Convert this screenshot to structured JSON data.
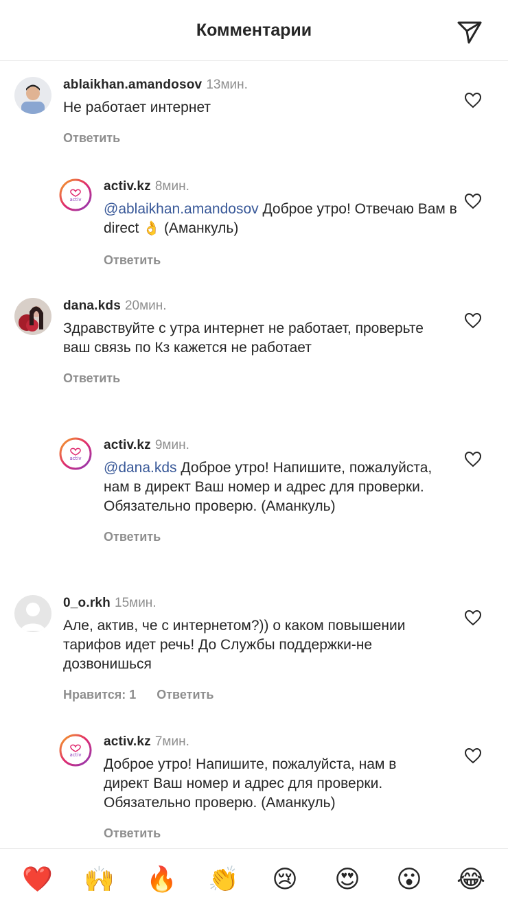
{
  "header": {
    "title": "Комментарии",
    "share_icon": "paper-plane-icon"
  },
  "comments": [
    {
      "username": "ablaikhan.amandosov",
      "time": "13мин.",
      "text": "Не работает интернет",
      "mention": "",
      "reply": "Ответить",
      "likes": ""
    },
    {
      "username": "activ.kz",
      "time": "8мин.",
      "mention": "@ablaikhan.amandosov",
      "text": " Доброе утро! Отвечаю Вам в direct",
      "emoji": "👌",
      "text_after": " (Аманкуль)",
      "reply": "Ответить"
    },
    {
      "username": "dana.kds",
      "time": "20мин.",
      "text": "Здравствуйте с утра интернет не работает, проверьте ваш связь по Кз кажется не работает",
      "reply": "Ответить"
    },
    {
      "username": "activ.kz",
      "time": "9мин.",
      "mention": "@dana.kds",
      "text": " Доброе утро! Напишите, пожалуйста, нам в директ Ваш номер и адрес для проверки. Обязательно проверю. (Аманкуль)",
      "reply": "Ответить"
    },
    {
      "username": "0_o.rkh",
      "time": "15мин.",
      "text": "Але, актив, че с интернетом?)) о каком повышении тарифов идет речь! До Службы поддержки-не дозвонишься",
      "likes": "Нравится: 1",
      "reply": "Ответить"
    },
    {
      "username": "activ.kz",
      "time": "7мин.",
      "text": "Доброе утро! Напишите, пожалуйста, нам в директ Ваш номер и адрес для проверки. Обязательно проверю. (Аманкуль)",
      "reply": "Ответить"
    }
  ],
  "reactions": [
    "❤️",
    "🙌",
    "🔥",
    "👏",
    "😢",
    "😍",
    "😮",
    "😂"
  ],
  "colors": {
    "mention": "#385898",
    "secondary": "#8e8e8e",
    "brand_gradient": [
      "#f5a623",
      "#e02a6f",
      "#8a3ab9"
    ]
  }
}
